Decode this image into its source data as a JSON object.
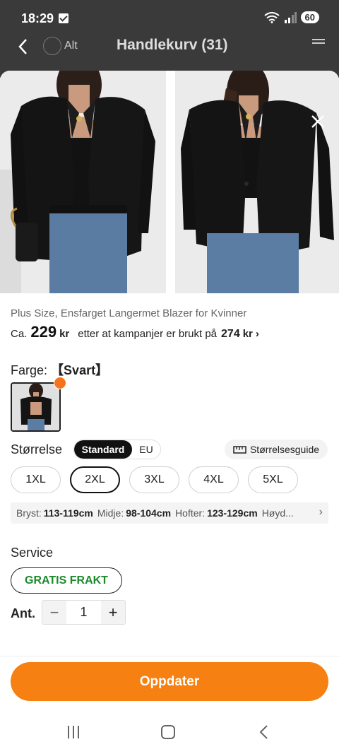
{
  "status_bar": {
    "time": "18:29",
    "battery": "60"
  },
  "background_header": {
    "alt_label": "Alt",
    "title": "Handlekurv (31)"
  },
  "product": {
    "title": "Plus Size, Ensfarget Langermet Blazer for Kvinner",
    "price_prefix": "Ca.",
    "price": "229",
    "currency": "kr",
    "price_note": "etter at kampanjer er brukt på",
    "original_price": "274",
    "original_currency": "kr"
  },
  "color": {
    "label": "Farge:",
    "value": "【Svart】"
  },
  "size": {
    "label": "Størrelse",
    "toggle_active": "Standard",
    "toggle_inactive": "EU",
    "guide_label": "Størrelsesguide",
    "options": [
      "1XL",
      "2XL",
      "3XL",
      "4XL",
      "5XL"
    ],
    "selected": "2XL",
    "measurements": [
      {
        "name": "Bryst:",
        "value": "113-119cm"
      },
      {
        "name": "Midje:",
        "value": "98-104cm"
      },
      {
        "name": "Hofter:",
        "value": "123-129cm"
      },
      {
        "name": "Høyd...",
        "value": ""
      }
    ]
  },
  "service": {
    "label": "Service",
    "free_shipping": "GRATIS FRAKT"
  },
  "quantity": {
    "label": "Ant.",
    "value": "1",
    "minus": "−",
    "plus": "+"
  },
  "actions": {
    "update_label": "Oppdater"
  },
  "colors": {
    "accent": "#f78012",
    "free_shipping_text": "#1a8a2a",
    "fire_badge": "#f5741b"
  }
}
